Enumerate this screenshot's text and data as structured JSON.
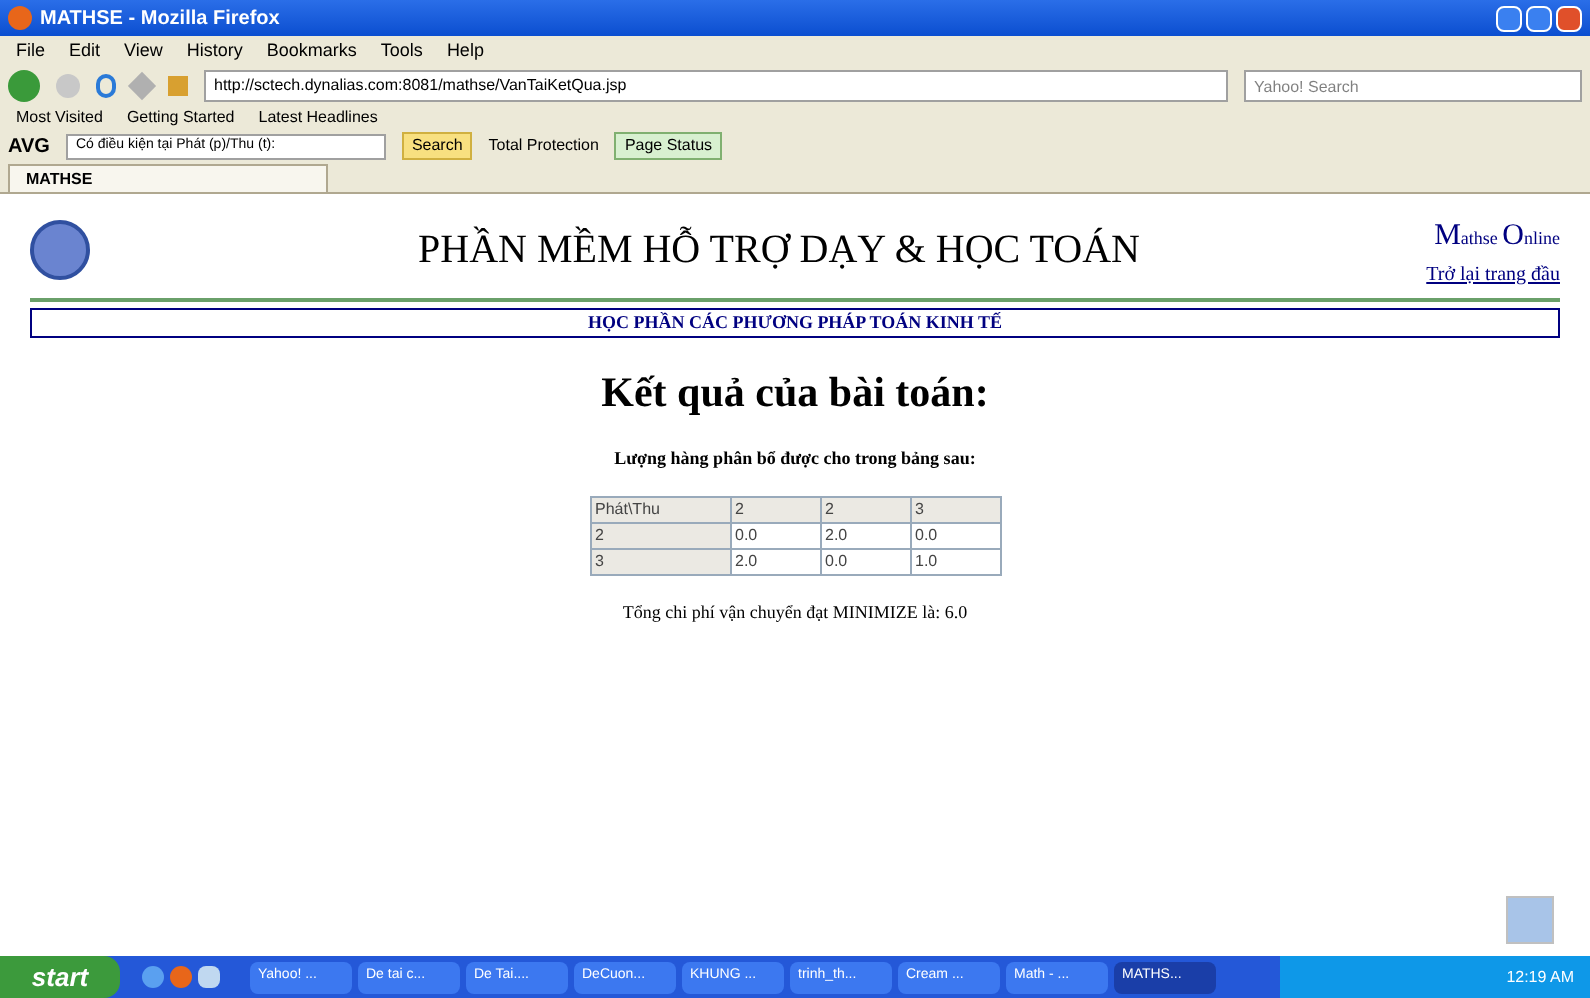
{
  "window": {
    "title": "MATHSE - Mozilla Firefox"
  },
  "menu": [
    "File",
    "Edit",
    "View",
    "History",
    "Bookmarks",
    "Tools",
    "Help"
  ],
  "nav": {
    "url": "http://sctech.dynalias.com:8081/mathse/VanTaiKetQua.jsp",
    "search_placeholder": "Yahoo! Search"
  },
  "bookmarks": [
    "Most Visited",
    "Getting Started",
    "Latest Headlines"
  ],
  "toolbar": {
    "brand": "AVG",
    "search_value": "Có điều kiện tại Phát (p)/Thu (t):",
    "search_button": "Search",
    "protection": "Total Protection",
    "page_status": "Page Status"
  },
  "tabs": [
    {
      "label": "MATHSE",
      "selected": true
    }
  ],
  "page": {
    "title": "PHẦN MỀM HỖ TRỢ DẠY & HỌC TOÁN",
    "brand": [
      {
        "text": "M",
        "kind": "big"
      },
      {
        "text": "athse ",
        "kind": "small"
      },
      {
        "text": "O",
        "kind": "big"
      },
      {
        "text": "nline",
        "kind": "small"
      }
    ],
    "back_link": "Trở lại trang đầu",
    "subtitle": "HỌC PHẦN CÁC PHƯƠNG PHÁP TOÁN KINH TẾ",
    "heading": "Kết quả của bài toán:",
    "caption": "Lượng hàng phân bổ được cho trong bảng sau:",
    "table": {
      "columns": [
        "Phát\\Thu",
        "2",
        "2",
        "3"
      ],
      "rows": [
        [
          "2",
          "0.0",
          "2.0",
          "0.0"
        ],
        [
          "3",
          "2.0",
          "0.0",
          "1.0"
        ]
      ]
    },
    "total": "Tổng chi phí vận chuyển đạt MINIMIZE là: 6.0"
  },
  "taskbar": {
    "start": "start",
    "tasks": [
      {
        "label": "Yahoo! ...",
        "selected": false
      },
      {
        "label": "De tai c...",
        "selected": false
      },
      {
        "label": "De Tai....",
        "selected": false
      },
      {
        "label": "DeCuon...",
        "selected": false
      },
      {
        "label": "KHUNG ...",
        "selected": false
      },
      {
        "label": "trinh_th...",
        "selected": false
      },
      {
        "label": "Cream ...",
        "selected": false
      },
      {
        "label": "Math - ...",
        "selected": false
      },
      {
        "label": "MATHS...",
        "selected": true
      }
    ],
    "clock": "12:19 AM"
  }
}
